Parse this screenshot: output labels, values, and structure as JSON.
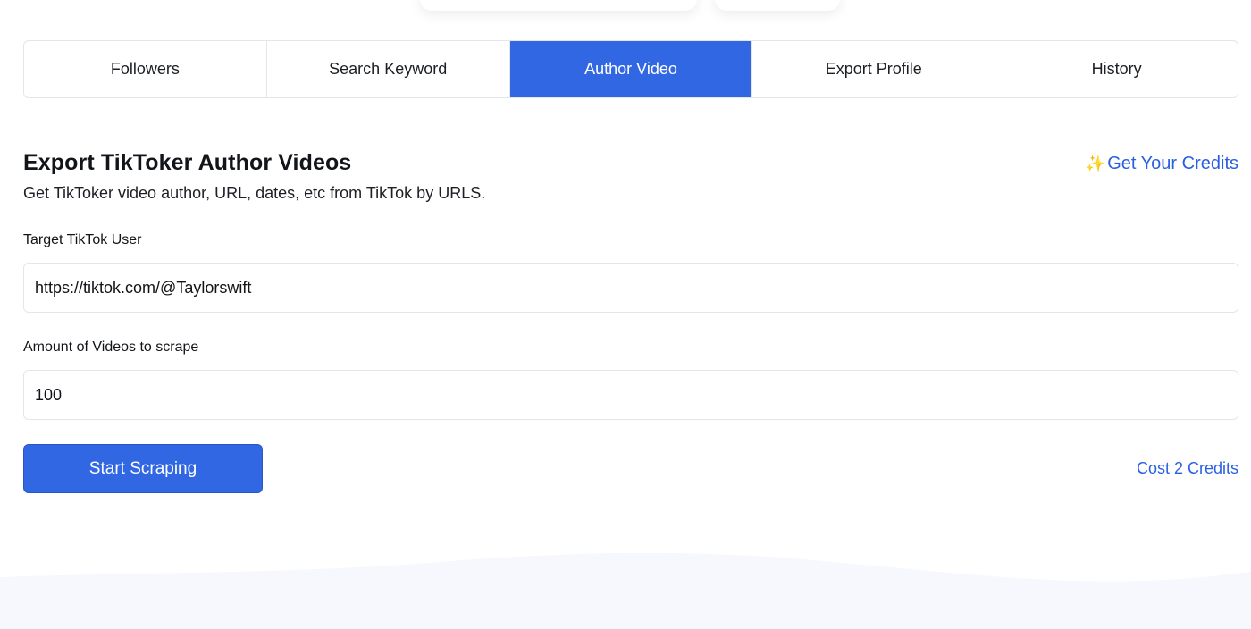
{
  "tabs": [
    {
      "label": "Followers",
      "active": false
    },
    {
      "label": "Search Keyword",
      "active": false
    },
    {
      "label": "Author Video",
      "active": true
    },
    {
      "label": "Export Profile",
      "active": false
    },
    {
      "label": "History",
      "active": false
    }
  ],
  "header": {
    "title": "Export TikToker Author Videos",
    "subtitle": "Get TikToker video author, URL, dates, etc from TikTok by URLS.",
    "credits_link": "Get Your Credits",
    "sparkle_icon": "sparkles-icon"
  },
  "form": {
    "target_label": "Target TikTok User",
    "target_value": "https://tiktok.com/@Taylorswift",
    "amount_label": "Amount of Videos to scrape",
    "amount_value": "100",
    "start_button": "Start Scraping",
    "cost_text": "Cost 2 Credits"
  },
  "colors": {
    "accent": "#3167e3",
    "link": "#2a5fe0",
    "border": "#e3e6ea",
    "wave": "#f6f8fd"
  }
}
